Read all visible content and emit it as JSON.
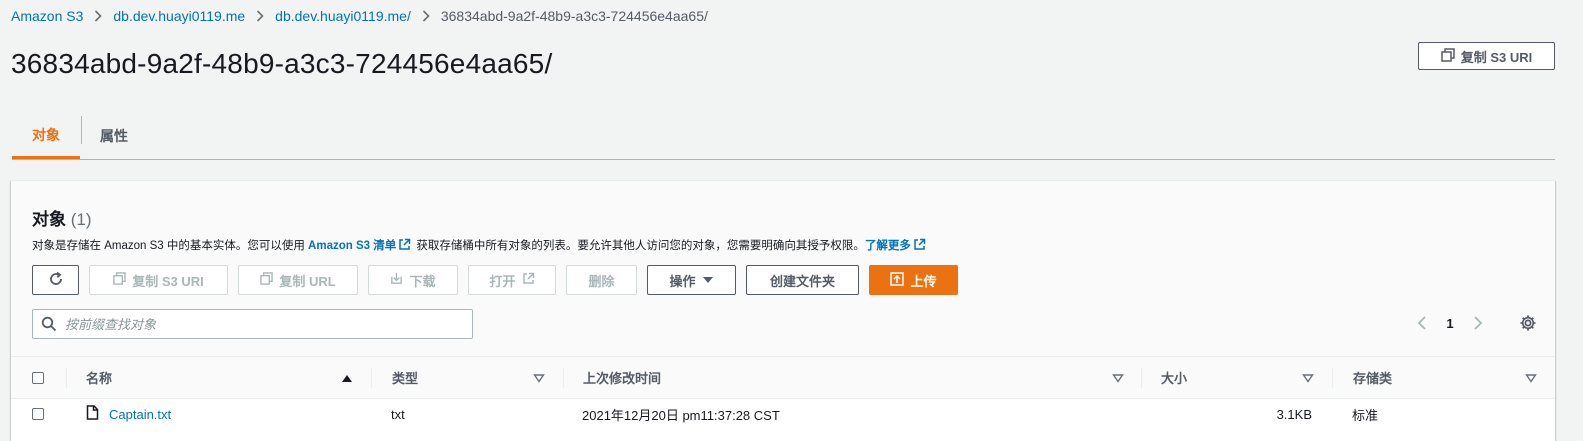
{
  "breadcrumb": {
    "items": [
      "Amazon S3",
      "db.dev.huayi0119.me",
      "db.dev.huayi0119.me/"
    ],
    "current": "36834abd-9a2f-48b9-a3c3-724456e4aa65/"
  },
  "page": {
    "title": "36834abd-9a2f-48b9-a3c3-724456e4aa65/",
    "copy_uri_label": "复制 S3 URI"
  },
  "tabs": [
    {
      "label": "对象",
      "active": true
    },
    {
      "label": "属性",
      "active": false
    }
  ],
  "objects_panel": {
    "title": "对象",
    "count": "(1)",
    "desc_prefix": "对象是存储在 Amazon S3 中的基本实体。您可以使用 ",
    "desc_link": "Amazon S3 清单",
    "desc_middle": " 获取存储桶中所有对象的列表。要允许其他人访问您的对象，您需要明确向其授予权限。",
    "desc_learn_more": "了解更多"
  },
  "toolbar": {
    "copy_s3_uri": "复制 S3 URI",
    "copy_url": "复制 URL",
    "download": "下载",
    "open": "打开",
    "delete": "删除",
    "actions": "操作",
    "create_folder": "创建文件夹",
    "upload": "上传"
  },
  "search": {
    "placeholder": "按前缀查找对象"
  },
  "pagination": {
    "page": "1"
  },
  "table": {
    "columns": [
      "名称",
      "类型",
      "上次修改时间",
      "大小",
      "存储类"
    ],
    "rows": [
      {
        "name": "Captain.txt",
        "type": "txt",
        "last_modified": "2021年12月20日 pm11:37:28 CST",
        "size": "3.1KB",
        "storage_class": "标准"
      }
    ]
  },
  "colors": {
    "accent": "#ec7211",
    "link": "#0073bb"
  }
}
